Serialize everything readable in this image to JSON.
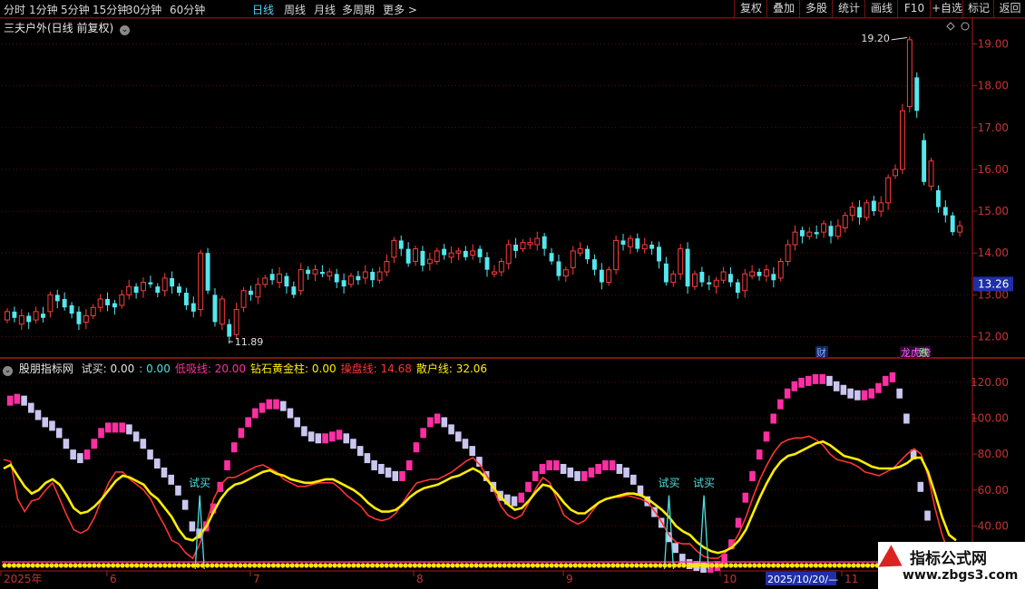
{
  "toolbar": {
    "periods": [
      "分时",
      "1分钟",
      "5分钟",
      "15分钟",
      "30分钟",
      "60分钟",
      "日线",
      "周线",
      "月线",
      "多周期",
      "更多 >"
    ],
    "active_period": "日线",
    "right_buttons": [
      "复权",
      "叠加",
      "多股",
      "统计",
      "画线",
      "F10",
      "+自选",
      "标记",
      "返回"
    ]
  },
  "main_panel": {
    "title": "三夫户外(日线 前复权)",
    "high_marker": "19.20",
    "low_marker": "11.89",
    "current_price_tag": "13.26",
    "event_tag_cai": "财",
    "event_tag_longhu": "龙虎榜",
    "event_tag_die": "跌"
  },
  "indicator_panel": {
    "name": "股朋指标网",
    "legend": [
      {
        "label": "试买: ",
        "value": "0.00",
        "color": "#e0e0e0"
      },
      {
        "label": ": ",
        "value": "0.00",
        "color": "#4fe0e0"
      },
      {
        "label": "低吸线: ",
        "value": "20.00",
        "color": "#ff3399"
      },
      {
        "label": "钻石黄金柱: ",
        "value": "0.00",
        "color": "#ffee00"
      },
      {
        "label": "操盘线: ",
        "value": "14.68",
        "color": "#ff3333"
      },
      {
        "label": "散户线: ",
        "value": "32.06",
        "color": "#ffee00"
      }
    ],
    "buy_signal_label": "试买"
  },
  "x_axis": {
    "labels": [
      "2025年",
      "6",
      "7",
      "8",
      "9",
      "10",
      "2025/10/20/—",
      "11"
    ]
  },
  "watermark": {
    "title": "指标公式网",
    "url": "www.zbgs3.com"
  },
  "chart_data": [
    {
      "type": "candlestick",
      "title": "三夫户外(日线 前复权)",
      "ylim": [
        11.6,
        19.4
      ],
      "yticks": [
        "19.00",
        "18.00",
        "17.00",
        "16.00",
        "15.00",
        "14.00",
        "13.00",
        "12.00"
      ],
      "ytick_values": [
        19,
        18,
        17,
        16,
        15,
        14,
        13,
        12
      ],
      "grid": true,
      "candles": [
        [
          12.4,
          12.6
        ],
        [
          12.6,
          12.45
        ],
        [
          12.3,
          12.5
        ],
        [
          12.5,
          12.35
        ],
        [
          12.4,
          12.6
        ],
        [
          12.55,
          12.45
        ],
        [
          12.6,
          13.0
        ],
        [
          13.0,
          12.85
        ],
        [
          12.9,
          12.7
        ],
        [
          12.75,
          12.55
        ],
        [
          12.6,
          12.3
        ],
        [
          12.35,
          12.5
        ],
        [
          12.5,
          12.7
        ],
        [
          12.7,
          12.9
        ],
        [
          12.9,
          12.75
        ],
        [
          12.8,
          12.7
        ],
        [
          12.75,
          13.0
        ],
        [
          13.0,
          13.2
        ],
        [
          13.2,
          13.05
        ],
        [
          13.1,
          13.3
        ],
        [
          13.3,
          13.25
        ],
        [
          13.2,
          13.05
        ],
        [
          13.1,
          13.4
        ],
        [
          13.4,
          13.2
        ],
        [
          13.2,
          13.05
        ],
        [
          13.05,
          12.75
        ],
        [
          12.8,
          12.6
        ],
        [
          12.65,
          14.0
        ],
        [
          14.0,
          13.1
        ],
        [
          13.0,
          12.35
        ],
        [
          12.3,
          12.9
        ],
        [
          12.3,
          12.0
        ],
        [
          12.05,
          12.65
        ],
        [
          12.7,
          13.1
        ],
        [
          13.1,
          13.0
        ],
        [
          12.95,
          13.25
        ],
        [
          13.25,
          13.4
        ],
        [
          13.5,
          13.35
        ],
        [
          13.3,
          13.5
        ],
        [
          13.45,
          13.2
        ],
        [
          13.2,
          13.0
        ],
        [
          13.1,
          13.6
        ],
        [
          13.6,
          13.5
        ],
        [
          13.5,
          13.6
        ],
        [
          13.55,
          13.5
        ],
        [
          13.45,
          13.55
        ],
        [
          13.5,
          13.3
        ],
        [
          13.35,
          13.2
        ],
        [
          13.25,
          13.45
        ],
        [
          13.45,
          13.35
        ],
        [
          13.4,
          13.55
        ],
        [
          13.55,
          13.35
        ],
        [
          13.35,
          13.55
        ],
        [
          13.55,
          13.8
        ],
        [
          13.9,
          14.3
        ],
        [
          14.3,
          14.1
        ],
        [
          14.1,
          13.75
        ],
        [
          13.8,
          14.1
        ],
        [
          14.05,
          13.7
        ],
        [
          13.75,
          13.85
        ],
        [
          13.8,
          14.05
        ],
        [
          14.1,
          13.95
        ],
        [
          13.9,
          14.0
        ],
        [
          14.0,
          14.05
        ],
        [
          14.05,
          13.9
        ],
        [
          13.95,
          14.05
        ],
        [
          14.1,
          13.9
        ],
        [
          13.9,
          13.6
        ],
        [
          13.5,
          13.55
        ],
        [
          13.55,
          13.8
        ],
        [
          13.75,
          14.2
        ],
        [
          14.2,
          14.05
        ],
        [
          14.1,
          14.25
        ],
        [
          14.2,
          14.25
        ],
        [
          14.2,
          14.35
        ],
        [
          14.4,
          14.1
        ],
        [
          14.0,
          13.8
        ],
        [
          13.8,
          13.45
        ],
        [
          13.45,
          13.6
        ],
        [
          13.65,
          14.05
        ],
        [
          14.0,
          14.1
        ],
        [
          14.1,
          13.85
        ],
        [
          13.85,
          13.6
        ],
        [
          13.6,
          13.3
        ],
        [
          13.3,
          13.6
        ],
        [
          13.6,
          14.3
        ],
        [
          14.3,
          14.2
        ],
        [
          14.15,
          14.35
        ],
        [
          14.35,
          14.1
        ],
        [
          14.1,
          14.2
        ],
        [
          14.2,
          14.1
        ],
        [
          14.15,
          13.8
        ],
        [
          13.75,
          13.3
        ],
        [
          13.3,
          13.5
        ],
        [
          13.5,
          14.1
        ],
        [
          14.1,
          13.2
        ],
        [
          13.2,
          13.5
        ],
        [
          13.55,
          13.3
        ],
        [
          13.3,
          13.25
        ],
        [
          13.2,
          13.35
        ],
        [
          13.35,
          13.55
        ],
        [
          13.5,
          13.3
        ],
        [
          13.3,
          13.05
        ],
        [
          13.1,
          13.5
        ],
        [
          13.45,
          13.55
        ],
        [
          13.55,
          13.45
        ],
        [
          13.45,
          13.6
        ],
        [
          13.5,
          13.35
        ],
        [
          13.4,
          13.8
        ],
        [
          13.8,
          14.2
        ],
        [
          14.2,
          14.5
        ],
        [
          14.55,
          14.4
        ],
        [
          14.4,
          14.5
        ],
        [
          14.5,
          14.45
        ],
        [
          14.5,
          14.7
        ],
        [
          14.65,
          14.4
        ],
        [
          14.4,
          14.65
        ],
        [
          14.6,
          14.9
        ],
        [
          14.9,
          15.1
        ],
        [
          15.1,
          14.85
        ],
        [
          14.85,
          15.2
        ],
        [
          15.25,
          15.0
        ],
        [
          15.0,
          15.2
        ],
        [
          15.2,
          15.8
        ],
        [
          15.85,
          16.0
        ],
        [
          16.0,
          17.4
        ],
        [
          17.5,
          19.1
        ],
        [
          18.2,
          17.4
        ],
        [
          16.7,
          15.7
        ],
        [
          15.6,
          16.2
        ],
        [
          15.5,
          15.1
        ],
        [
          15.1,
          14.9
        ],
        [
          14.9,
          14.5
        ],
        [
          14.5,
          14.65
        ]
      ]
    },
    {
      "type": "line",
      "title": "股朋指标网",
      "ylim": [
        16,
        130
      ],
      "yticks": [
        "120.00",
        "100.00",
        "80.00",
        "60.00",
        "40.00",
        "20.00"
      ],
      "ytick_values": [
        120,
        100,
        80,
        60,
        40,
        20
      ],
      "grid": true,
      "series": [
        {
          "name": "散户线",
          "color": "#ffee00",
          "values": [
            72,
            74,
            68,
            62,
            58,
            60,
            64,
            66,
            63,
            57,
            50,
            47,
            48,
            51,
            55,
            60,
            65,
            68,
            67,
            65,
            63,
            58,
            55,
            50,
            45,
            38,
            33,
            32,
            35,
            40,
            48,
            55,
            60,
            63,
            64,
            66,
            68,
            70,
            71,
            69,
            68,
            66,
            65,
            64,
            64,
            65,
            66,
            66,
            64,
            62,
            60,
            57,
            53,
            50,
            48,
            48,
            49,
            52,
            56,
            59,
            61,
            62,
            63,
            65,
            67,
            68,
            70,
            72,
            70,
            66,
            61,
            56,
            52,
            49,
            50,
            54,
            59,
            63,
            62,
            58,
            53,
            49,
            47,
            47,
            50,
            53,
            55,
            56,
            57,
            58,
            58,
            57,
            55,
            52,
            49,
            45,
            40,
            37,
            35,
            31,
            28,
            26,
            25,
            26,
            28,
            32,
            38,
            47,
            56,
            64,
            71,
            76,
            79,
            80,
            82,
            84,
            86,
            87,
            85,
            82,
            79,
            78,
            77,
            75,
            73,
            72,
            72,
            72,
            73,
            75,
            78,
            78,
            70,
            58,
            45,
            35,
            32
          ]
        },
        {
          "name": "操盘线",
          "color": "#ff3333",
          "values": [
            77,
            76,
            55,
            48,
            54,
            55,
            60,
            64,
            55,
            46,
            38,
            36,
            38,
            45,
            55,
            64,
            70,
            70,
            66,
            63,
            60,
            55,
            47,
            40,
            32,
            30,
            25,
            22,
            30,
            42,
            55,
            63,
            67,
            67,
            69,
            71,
            73,
            74,
            72,
            70,
            66,
            64,
            62,
            62,
            63,
            64,
            64,
            64,
            61,
            57,
            54,
            51,
            46,
            44,
            43,
            44,
            47,
            53,
            59,
            64,
            65,
            66,
            66,
            68,
            70,
            73,
            76,
            78,
            74,
            68,
            60,
            51,
            46,
            44,
            46,
            53,
            61,
            67,
            64,
            55,
            46,
            43,
            41,
            43,
            48,
            53,
            55,
            56,
            56,
            57,
            56,
            55,
            53,
            48,
            42,
            35,
            31,
            30,
            30,
            26,
            23,
            22,
            22,
            25,
            29,
            36,
            45,
            56,
            66,
            74,
            81,
            86,
            88,
            89,
            89,
            90,
            88,
            85,
            80,
            77,
            76,
            75,
            73,
            70,
            69,
            68,
            70,
            72,
            76,
            80,
            83,
            80,
            68,
            50,
            35,
            25,
            20
          ]
        },
        {
          "name": "低吸线",
          "color": "#ff3399",
          "values": [
            20,
            20,
            20,
            20,
            20,
            20,
            20,
            20,
            20,
            20,
            20,
            20,
            20,
            20,
            20,
            20,
            20,
            20,
            20,
            20,
            20,
            20,
            20,
            20,
            20,
            20,
            20,
            20,
            20,
            20,
            20,
            20,
            20,
            20,
            20,
            20,
            20,
            20,
            20,
            20,
            20,
            20,
            20,
            20,
            20,
            20,
            20,
            20,
            20,
            20,
            20,
            20,
            20,
            20,
            20,
            20,
            20,
            20,
            20,
            20,
            20,
            20,
            20,
            20,
            20,
            20,
            20,
            20,
            20,
            20,
            20,
            20,
            20,
            20,
            20,
            20,
            20,
            20,
            20,
            20,
            20,
            20,
            20,
            20,
            20,
            20,
            20,
            20,
            20,
            20,
            20,
            20,
            20,
            20,
            20,
            20,
            20,
            20,
            20,
            20,
            20,
            20,
            20,
            20,
            20,
            20,
            20,
            20,
            20,
            20,
            20,
            20,
            20,
            20,
            20,
            20,
            20,
            20,
            20,
            20,
            20,
            20,
            20,
            20,
            20,
            20,
            20,
            20,
            20,
            20,
            20,
            20,
            20,
            20,
            20,
            20,
            20
          ]
        },
        {
          "name": "股朋指标网",
          "color": "#ff22aa",
          "values": [
            108,
            110,
            111,
            110,
            106,
            102,
            98,
            96,
            92,
            86,
            80,
            78,
            80,
            86,
            92,
            95,
            95,
            95,
            94,
            90,
            86,
            80,
            75,
            70,
            66,
            60,
            52,
            40,
            36,
            40,
            50,
            62,
            74,
            84,
            92,
            98,
            103,
            106,
            108,
            108,
            107,
            103,
            98,
            93,
            90,
            89,
            89,
            90,
            91,
            89,
            86,
            82,
            78,
            74,
            72,
            70,
            68,
            68,
            74,
            84,
            92,
            98,
            100,
            98,
            94,
            90,
            86,
            82,
            76,
            68,
            62,
            57,
            55,
            54,
            56,
            62,
            68,
            72,
            74,
            74,
            72,
            70,
            68,
            68,
            70,
            72,
            74,
            74,
            72,
            70,
            66,
            60,
            54,
            48,
            42,
            34,
            28,
            22,
            19,
            18,
            17,
            17,
            18,
            22,
            30,
            42,
            56,
            68,
            80,
            90,
            100,
            108,
            114,
            118,
            120,
            121,
            122,
            122,
            121,
            118,
            116,
            114,
            113,
            113,
            114,
            117,
            121,
            123,
            114,
            100,
            80,
            62,
            46
          ]
        }
      ],
      "buy_signals": [
        {
          "index": 28,
          "label": "试买"
        },
        {
          "index": 95,
          "label": "试买"
        },
        {
          "index": 100,
          "label": "试买"
        }
      ]
    }
  ]
}
